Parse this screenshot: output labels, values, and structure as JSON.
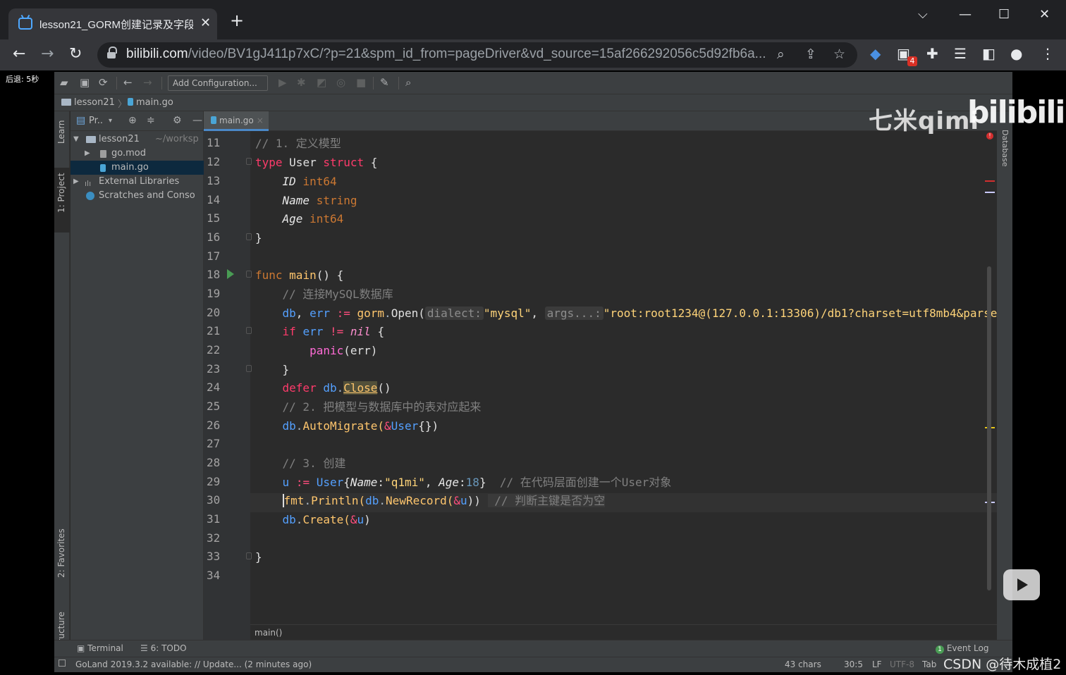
{
  "browser": {
    "tab_title": "lesson21_GORM创建记录及字段",
    "tab_close": "✕",
    "new_tab": "+",
    "url_domain": "bilibili.com",
    "url_path": "/video/BV1gJ411p7xC/?p=21&spm_id_from=pageDriver&vd_source=15af266292056c5d92fb6a...",
    "extension_badge": "4",
    "window_controls": {
      "tab_search": "⌵",
      "minimize": "—",
      "maximize": "☐",
      "close": "✕"
    },
    "nav": {
      "back": "←",
      "forward": "→",
      "reload": "↻"
    },
    "omni_icons": {
      "zoom": "⌕",
      "share": "⇪",
      "bookmark": "☆"
    }
  },
  "overlay": {
    "retreat_label": "后退: 5秒",
    "watermark_qimi": "七米qimi",
    "watermark_bilibili": "bilibili",
    "watermark_csdn": "CSDN @待木成植2"
  },
  "ide": {
    "run_config": "Add Configuration...",
    "breadcrumb": {
      "project": "lesson21",
      "file": "main.go"
    },
    "project_panel_title": "Pr..",
    "tree": [
      {
        "label": "lesson21",
        "suffix": "~/worksp"
      },
      {
        "label": "go.mod"
      },
      {
        "label": "main.go"
      },
      {
        "label": "External Libraries"
      },
      {
        "label": "Scratches and Conso"
      }
    ],
    "editor_tab": "main.go",
    "editor_tab_close": "×",
    "side_tabs": {
      "learn": "Learn",
      "project": "1: Project",
      "favorites": "2: Favorites",
      "structure": "Z: Structure",
      "database": "Database"
    },
    "line_numbers": [
      "11",
      "12",
      "13",
      "14",
      "15",
      "16",
      "17",
      "18",
      "19",
      "20",
      "21",
      "22",
      "23",
      "24",
      "25",
      "26",
      "27",
      "28",
      "29",
      "30",
      "31",
      "32",
      "33",
      "34"
    ],
    "code": {
      "l11": "// 1. 定义模型",
      "l12_kw": "type",
      "l12_name": "User",
      "l12_kw2": "struct",
      "l12_brace": "{",
      "l13_field": "ID",
      "l13_type": "int64",
      "l14_field": "Name",
      "l14_type": "string",
      "l15_field": "Age",
      "l15_type": "int64",
      "l16": "}",
      "l18_kw": "func",
      "l18_fn": "main",
      "l18_rest": "() {",
      "l19": "// 连接MySQL数据库",
      "l20_a": "db",
      "l20_b": ", ",
      "l20_c": "err",
      "l20_op": ":=",
      "l20_pkg": "gorm",
      "l20_fn": "Open(",
      "l20_hint1": "dialect:",
      "l20_s1": "\"mysql\"",
      "l20_comma": ",",
      "l20_hint2": "args...:",
      "l20_s2": "\"root:root1234@(127.0.0.1:13306)/db1?charset=utf8mb4&parse",
      "l21_kw": "if",
      "l21_err": "err",
      "l21_op": "!=",
      "l21_nil": "nil",
      "l21_brace": "{",
      "l22_fn": "panic",
      "l22_arg": "(err)",
      "l23": "}",
      "l24_kw": "defer",
      "l24_db": "db",
      "l24_fn": "Close",
      "l24_rest": "()",
      "l25": "// 2. 把模型与数据库中的表对应起来",
      "l26_db": "db",
      "l26_fn": "AutoMigrate(",
      "l26_amp": "&",
      "l26_type": "User",
      "l26_rest": "{})",
      "l28": "// 3. 创建",
      "l29_u": "u",
      "l29_op": ":=",
      "l29_type": "User",
      "l29_f1": "Name",
      "l29_s": "\"q1mi\"",
      "l29_f2": "Age",
      "l29_n": "18",
      "l29_cm": "// 在代码层面创建一个User对象",
      "l30_pkg": "fmt",
      "l30_fn": "Println(",
      "l30_db": "db",
      "l30_fn2": "NewRecord(",
      "l30_amp": "&",
      "l30_u": "u",
      "l30_close": "))",
      "l30_cm": "// 判断主键是否为空",
      "l31_db": "db",
      "l31_fn": "Create(",
      "l31_amp": "&",
      "l31_u": "u",
      "l31_close": ")",
      "l33": "}"
    },
    "editor_breadcrumb": "main()",
    "bottom_tools": {
      "terminal": "Terminal",
      "todo": "6: TODO",
      "event_log": "Event Log",
      "event_count": "1"
    },
    "status": {
      "message": "GoLand 2019.3.2 available: // Update... (2 minutes ago)",
      "chars": "43 chars",
      "position": "30:5",
      "line_sep": "LF",
      "encoding": "UTF-8",
      "indent": "Tab"
    }
  }
}
